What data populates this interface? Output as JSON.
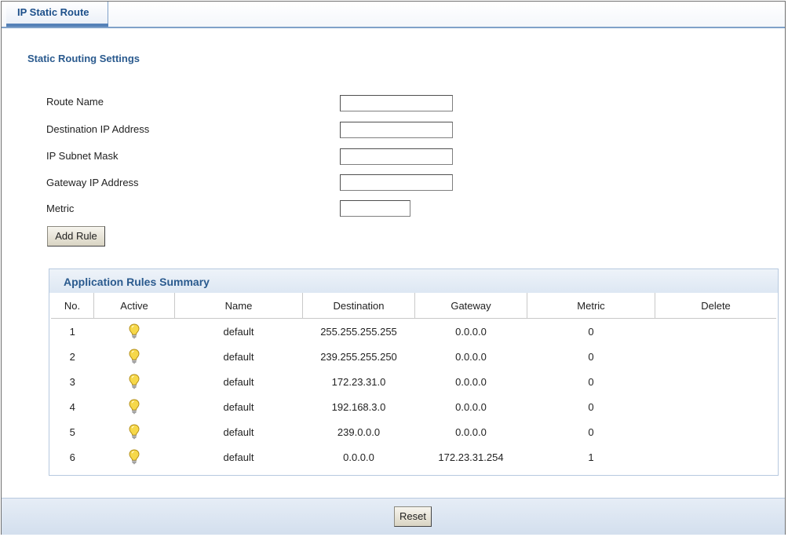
{
  "tab": {
    "label": "IP Static Route"
  },
  "section": {
    "title": "Static Routing Settings"
  },
  "form": {
    "fields": [
      {
        "label": "Route Name",
        "value": ""
      },
      {
        "label": "Destination IP Address",
        "value": ""
      },
      {
        "label": "IP Subnet Mask",
        "value": ""
      },
      {
        "label": "Gateway IP Address",
        "value": ""
      },
      {
        "label": "Metric",
        "value": ""
      }
    ],
    "add_button": "Add Rule"
  },
  "summary": {
    "title": "Application Rules Summary",
    "columns": [
      "No.",
      "Active",
      "Name",
      "Destination",
      "Gateway",
      "Metric",
      "Delete"
    ],
    "rows": [
      {
        "no": "1",
        "active_icon": "lightbulb-icon",
        "name": "default",
        "destination": "255.255.255.255",
        "gateway": "0.0.0.0",
        "metric": "0",
        "delete": ""
      },
      {
        "no": "2",
        "active_icon": "lightbulb-icon",
        "name": "default",
        "destination": "239.255.255.250",
        "gateway": "0.0.0.0",
        "metric": "0",
        "delete": ""
      },
      {
        "no": "3",
        "active_icon": "lightbulb-icon",
        "name": "default",
        "destination": "172.23.31.0",
        "gateway": "0.0.0.0",
        "metric": "0",
        "delete": ""
      },
      {
        "no": "4",
        "active_icon": "lightbulb-icon",
        "name": "default",
        "destination": "192.168.3.0",
        "gateway": "0.0.0.0",
        "metric": "0",
        "delete": ""
      },
      {
        "no": "5",
        "active_icon": "lightbulb-icon",
        "name": "default",
        "destination": "239.0.0.0",
        "gateway": "0.0.0.0",
        "metric": "0",
        "delete": ""
      },
      {
        "no": "6",
        "active_icon": "lightbulb-icon",
        "name": "default",
        "destination": "0.0.0.0",
        "gateway": "172.23.31.254",
        "metric": "1",
        "delete": ""
      }
    ]
  },
  "footer": {
    "reset_button": "Reset"
  },
  "colors": {
    "accent": "#2a5a8e",
    "tab_border": "#7fa1c9",
    "bulb": "#f6d84a"
  }
}
